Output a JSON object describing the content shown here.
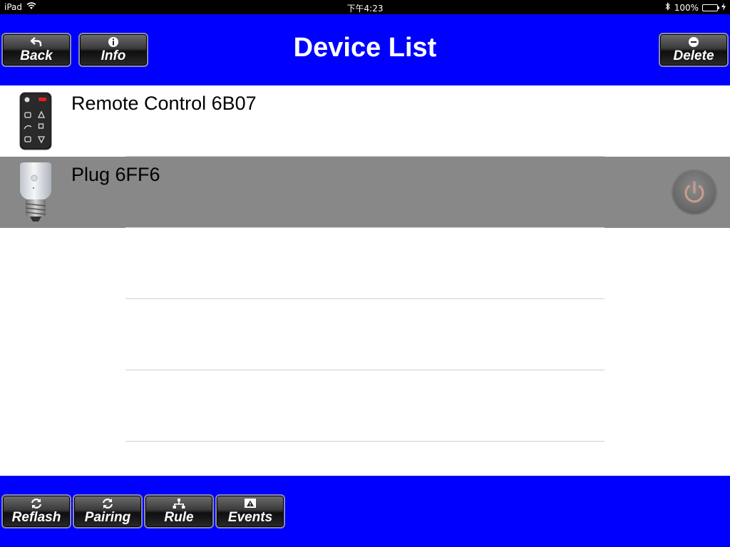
{
  "status_bar": {
    "device": "iPad",
    "time": "下午4:23",
    "battery": "100%"
  },
  "nav": {
    "title": "Device List",
    "back_label": "Back",
    "info_label": "Info",
    "delete_label": "Delete"
  },
  "devices": [
    {
      "name": "Remote Control 6B07",
      "icon": "remote-control-icon",
      "selected": false
    },
    {
      "name": "Plug 6FF6",
      "icon": "smart-plug-icon",
      "selected": true,
      "action_icon": "power-icon"
    }
  ],
  "toolbar": {
    "refresh_label": "Reflash",
    "pairing_label": "Pairing",
    "rule_label": "Rule",
    "events_label": "Events"
  },
  "colors": {
    "bar_background": "#0000ff",
    "selected_row": "#888888",
    "status_bar": "#000000",
    "battery_fill": "#4cd964"
  }
}
